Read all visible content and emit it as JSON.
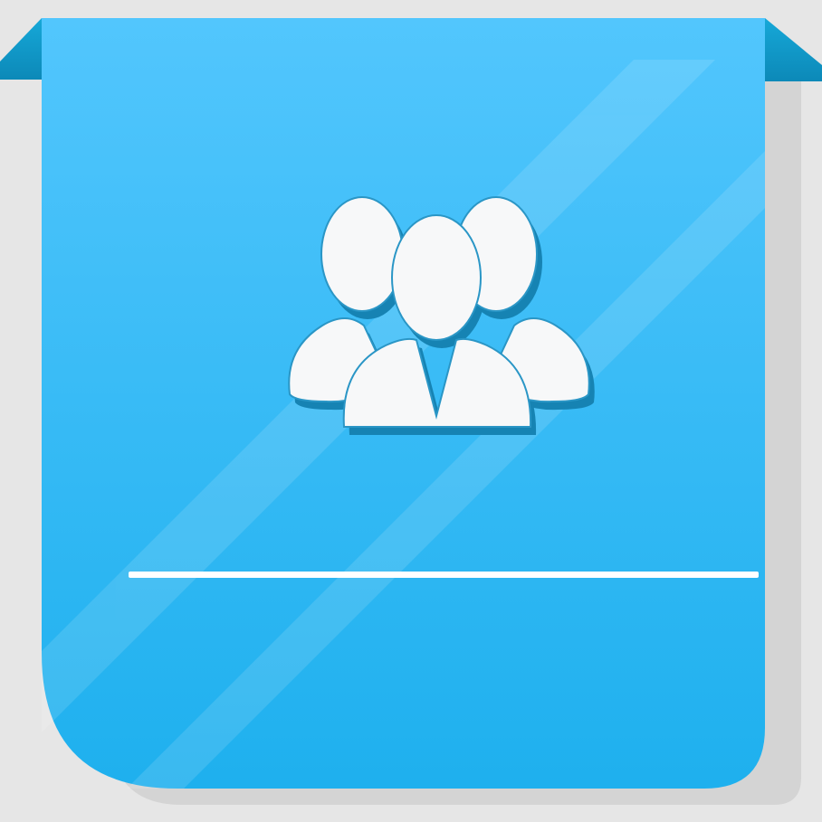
{
  "banner": {
    "icon": "users-group-icon",
    "colors": {
      "background": "#e6e6e6",
      "panel_top": "#52c6fd",
      "panel_bottom": "#1eb0ee",
      "fold": "#0d8ab9",
      "icon_fill": "#f7f8f9",
      "icon_shadow": "#1683b3",
      "divider": "#ffffff"
    }
  }
}
